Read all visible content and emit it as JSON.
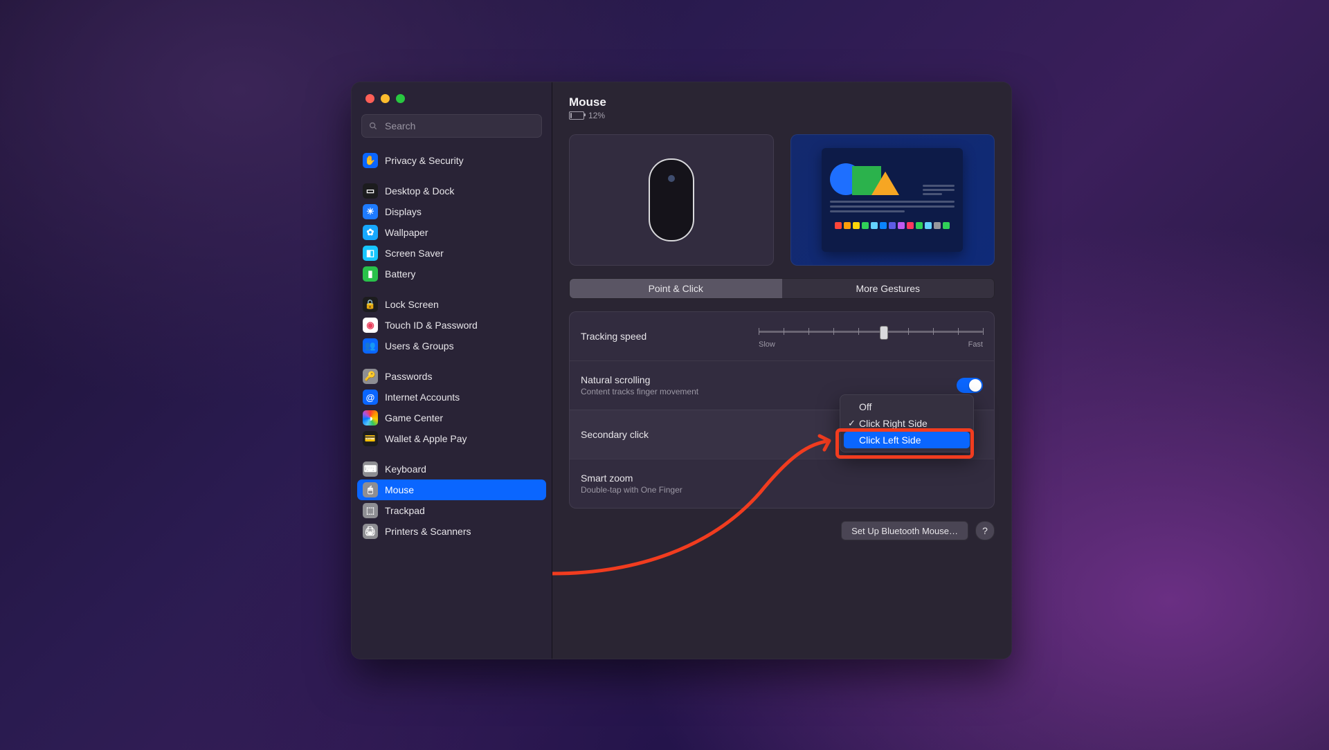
{
  "window": {
    "title": "Mouse",
    "battery_percent": "12%",
    "search_placeholder": "Search"
  },
  "sidebar": {
    "groups": [
      [
        {
          "label": "Privacy & Security",
          "icon_bg": "#0a66ff",
          "glyph": "✋"
        }
      ],
      [
        {
          "label": "Desktop & Dock",
          "icon_bg": "#1c1c1e",
          "glyph": "▭"
        },
        {
          "label": "Displays",
          "icon_bg": "#1e7bff",
          "glyph": "☀"
        },
        {
          "label": "Wallpaper",
          "icon_bg": "#17a8ff",
          "glyph": "✿"
        },
        {
          "label": "Screen Saver",
          "icon_bg": "#17c6ff",
          "glyph": "◧"
        },
        {
          "label": "Battery",
          "icon_bg": "#29c24a",
          "glyph": "▮"
        }
      ],
      [
        {
          "label": "Lock Screen",
          "icon_bg": "#1c1c1e",
          "glyph": "🔒"
        },
        {
          "label": "Touch ID & Password",
          "icon_bg": "#ffffff",
          "glyph": "◉",
          "glyph_color": "#e83e5b"
        },
        {
          "label": "Users & Groups",
          "icon_bg": "#0a66ff",
          "glyph": "👥"
        }
      ],
      [
        {
          "label": "Passwords",
          "icon_bg": "#8e8e93",
          "glyph": "🔑"
        },
        {
          "label": "Internet Accounts",
          "icon_bg": "#0a66ff",
          "glyph": "@"
        },
        {
          "label": "Game Center",
          "icon_bg": "#ffffff",
          "glyph": "◑",
          "gradient": true
        },
        {
          "label": "Wallet & Apple Pay",
          "icon_bg": "#1c1c1e",
          "glyph": "💳"
        }
      ],
      [
        {
          "label": "Keyboard",
          "icon_bg": "#8e8e93",
          "glyph": "⌨"
        },
        {
          "label": "Mouse",
          "icon_bg": "#8e8e93",
          "glyph": "🖱",
          "selected": true
        },
        {
          "label": "Trackpad",
          "icon_bg": "#8e8e93",
          "glyph": "⬚"
        },
        {
          "label": "Printers & Scanners",
          "icon_bg": "#8e8e93",
          "glyph": "🖨"
        }
      ]
    ]
  },
  "tabs": {
    "point_click": "Point & Click",
    "more_gestures": "More Gestures",
    "active": "point_click"
  },
  "rows": {
    "tracking": {
      "title": "Tracking speed",
      "slow": "Slow",
      "fast": "Fast",
      "value_index": 5,
      "tick_count": 10
    },
    "natural": {
      "title": "Natural scrolling",
      "sub": "Content tracks finger movement",
      "on": true
    },
    "secondary": {
      "title": "Secondary click"
    },
    "smart": {
      "title": "Smart zoom",
      "sub": "Double-tap with One Finger"
    }
  },
  "dropdown": {
    "items": [
      {
        "label": "Off"
      },
      {
        "label": "Click Right Side",
        "checked": true
      },
      {
        "label": "Click Left Side",
        "highlighted": true
      }
    ]
  },
  "footer": {
    "bluetooth": "Set Up Bluetooth Mouse…",
    "help": "?"
  },
  "colors": {
    "accent": "#0a66ff",
    "red_hl": "#f13c1f"
  },
  "swatch_colors": [
    "#ff453a",
    "#ff9f0a",
    "#ffd60a",
    "#30d158",
    "#64d2ff",
    "#0a84ff",
    "#5e5ce6",
    "#bf5af2",
    "#ff375f",
    "#30d158",
    "#64d2ff",
    "#98989d",
    "#30d158"
  ]
}
